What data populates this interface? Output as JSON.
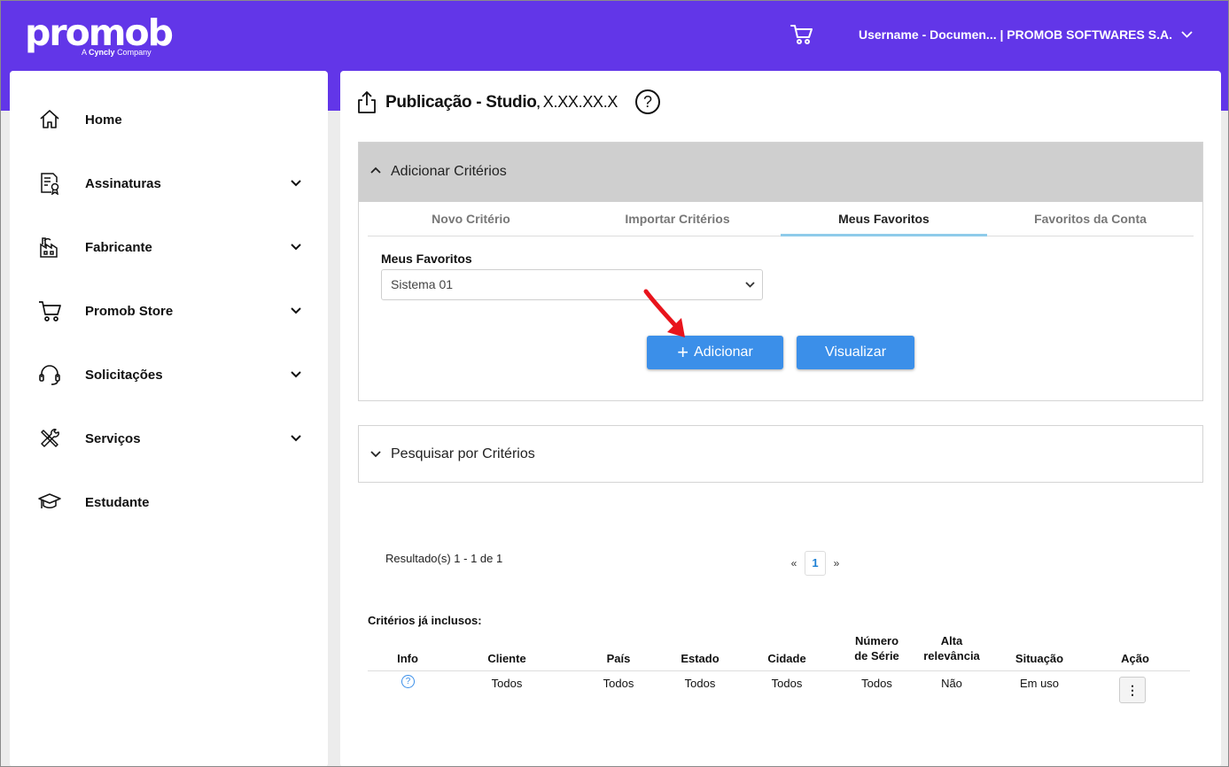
{
  "brand": {
    "logo_text": "promob",
    "tagline_prefix": "A",
    "tagline_brand": "Cyncly",
    "tagline_suffix": "Company",
    "accent": "#6236e8"
  },
  "header": {
    "user_label": "Username - Documen... | PROMOB SOFTWARES S.A."
  },
  "sidebar": {
    "items": [
      {
        "label": "Home",
        "icon": "home-icon"
      },
      {
        "label": "Assinaturas",
        "icon": "subscription-icon",
        "expandable": true
      },
      {
        "label": "Fabricante",
        "icon": "factory-icon",
        "expandable": true
      },
      {
        "label": "Promob Store",
        "icon": "cart-icon",
        "expandable": true
      },
      {
        "label": "Solicitações",
        "icon": "headset-icon",
        "expandable": true
      },
      {
        "label": "Serviços",
        "icon": "tools-icon",
        "expandable": true
      },
      {
        "label": "Estudante",
        "icon": "graduation-cap-icon"
      }
    ]
  },
  "page": {
    "title": "Publicação - Studio",
    "version": "X.XX.XX.X"
  },
  "add_panel": {
    "header": "Adicionar Critérios",
    "tabs": [
      "Novo Critério",
      "Importar Critérios",
      "Meus Favoritos",
      "Favoritos da Conta"
    ],
    "active_tab": "Meus Favoritos",
    "favorites_label": "Meus Favoritos",
    "favorites_value": "Sistema 01",
    "add_button": "Adicionar",
    "view_button": "Visualizar",
    "button_color": "#3b8fe9"
  },
  "search_panel": {
    "header": "Pesquisar por Critérios"
  },
  "results": {
    "summary": "Resultado(s) 1 - 1 de 1",
    "prev": "«",
    "page": "1",
    "next": "»"
  },
  "criteria": {
    "title": "Critérios já inclusos:",
    "columns": {
      "info": "Info",
      "cliente": "Cliente",
      "pais": "País",
      "estado": "Estado",
      "cidade": "Cidade",
      "numero_serie_1": "Número",
      "numero_serie_2": "de Série",
      "alta_relevancia_1": "Alta",
      "alta_relevancia_2": "relevância",
      "situacao": "Situação",
      "acao": "Ação"
    },
    "rows": [
      {
        "cliente": "Todos",
        "pais": "Todos",
        "estado": "Todos",
        "cidade": "Todos",
        "numero_serie": "Todos",
        "alta_relevancia": "Não",
        "situacao": "Em uso",
        "info_icon": "?",
        "action_icon": "⋮"
      }
    ]
  }
}
